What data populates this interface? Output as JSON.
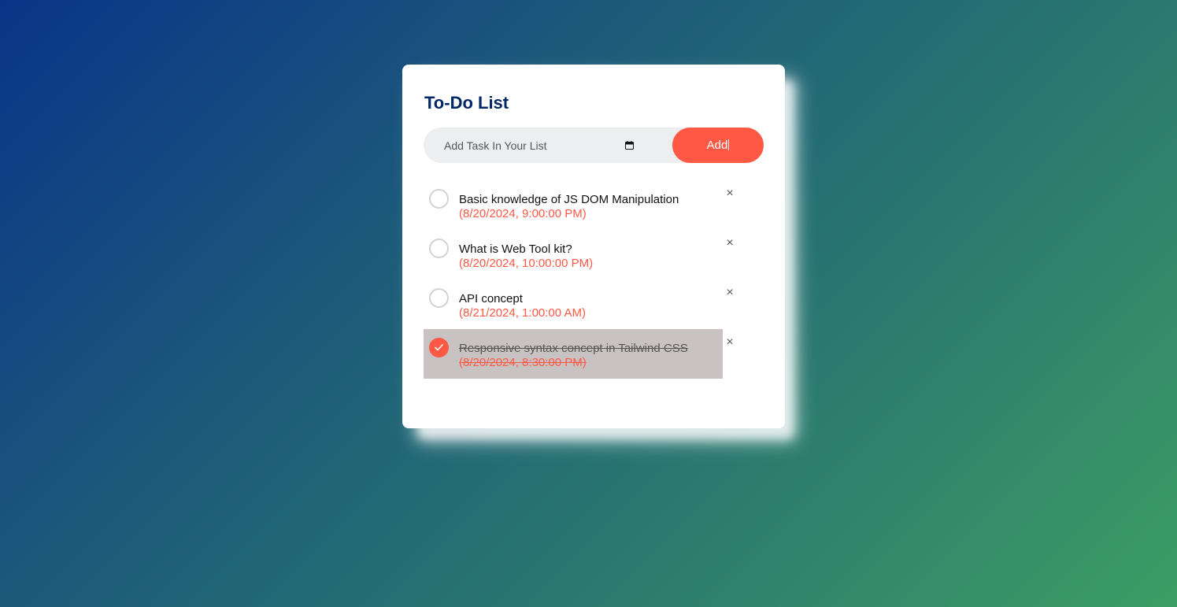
{
  "app": {
    "title": "To-Do List"
  },
  "input": {
    "placeholder": "Add Task In Your List",
    "value": "",
    "date_icon": "calendar-icon"
  },
  "add_button": {
    "label": "Add"
  },
  "tasks": [
    {
      "text": "Basic knowledge of JS DOM Manipulation",
      "date": "(8/20/2024, 9:00:00 PM)",
      "checked": false,
      "delete_label": "×"
    },
    {
      "text": "What is Web Tool kit?",
      "date": "(8/20/2024, 10:00:00 PM)",
      "checked": false,
      "delete_label": "×"
    },
    {
      "text": "API concept",
      "date": "(8/21/2024, 1:00:00 AM)",
      "checked": false,
      "delete_label": "×"
    },
    {
      "text": "Responsive syntax concept in Tailwind CSS",
      "date": "(8/20/2024, 8:30:00 PM)",
      "checked": true,
      "delete_label": "×"
    }
  ],
  "colors": {
    "accent": "#ff5945",
    "title": "#002765",
    "input_bg": "#edeef0",
    "checked_row_bg": "#c8c3c2",
    "gradient_start": "#0a3488",
    "gradient_end": "#3d9d64"
  }
}
